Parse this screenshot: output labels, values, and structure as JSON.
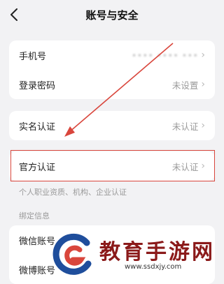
{
  "header": {
    "title": "账号与安全",
    "back_icon": "chevron-left-icon"
  },
  "account_card": {
    "phone": {
      "label": "手机号",
      "value": "•••• •••• •••"
    },
    "password": {
      "label": "登录密码",
      "value": "未设置"
    }
  },
  "realname_card": {
    "label": "实名认证",
    "value": "未认证"
  },
  "official_card": {
    "label": "官方认证",
    "value": "未认证",
    "hint": "个人职业资质、机构、企业认证"
  },
  "bind_section": {
    "title": "绑定信息",
    "items": [
      {
        "label": "微信账号"
      },
      {
        "label": "微博账号"
      }
    ]
  },
  "watermark": {
    "text_cn": "教育手游网",
    "url": "www.ssdxjy.com"
  },
  "colors": {
    "highlight": "#d9463c",
    "arrow": "#d9463c",
    "watermark_red": "#8b1a1a",
    "logo_blue": "#1f4e9c"
  }
}
